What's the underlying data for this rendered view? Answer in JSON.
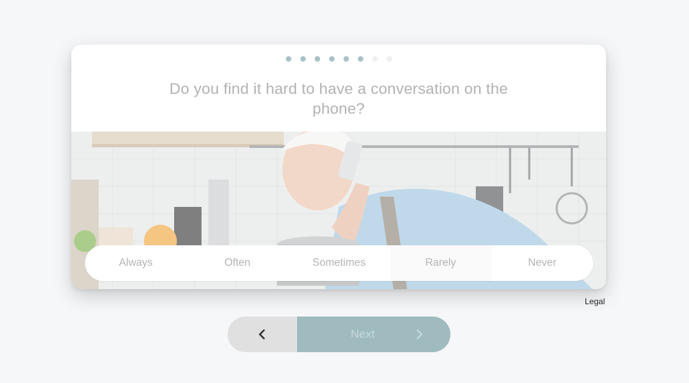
{
  "progress": {
    "total_steps": 8,
    "completed_steps": 6
  },
  "question": {
    "text": "Do you find it hard to have a conversation on the phone?"
  },
  "image": {
    "subject": "kitchen-phone-photo"
  },
  "answers": [
    {
      "label": "Always"
    },
    {
      "label": "Often"
    },
    {
      "label": "Sometimes"
    },
    {
      "label": "Rarely"
    },
    {
      "label": "Never"
    }
  ],
  "legal": {
    "label": "Legal"
  },
  "navigation": {
    "back_icon": "chevron-left-icon",
    "next_label": "Next",
    "next_icon": "chevron-right-icon"
  },
  "colors": {
    "accent": "#9fbbbf",
    "dot_active": "#a9c2c8",
    "dot_pending": "#eef0f2",
    "question_text": "#b2b2b2"
  }
}
